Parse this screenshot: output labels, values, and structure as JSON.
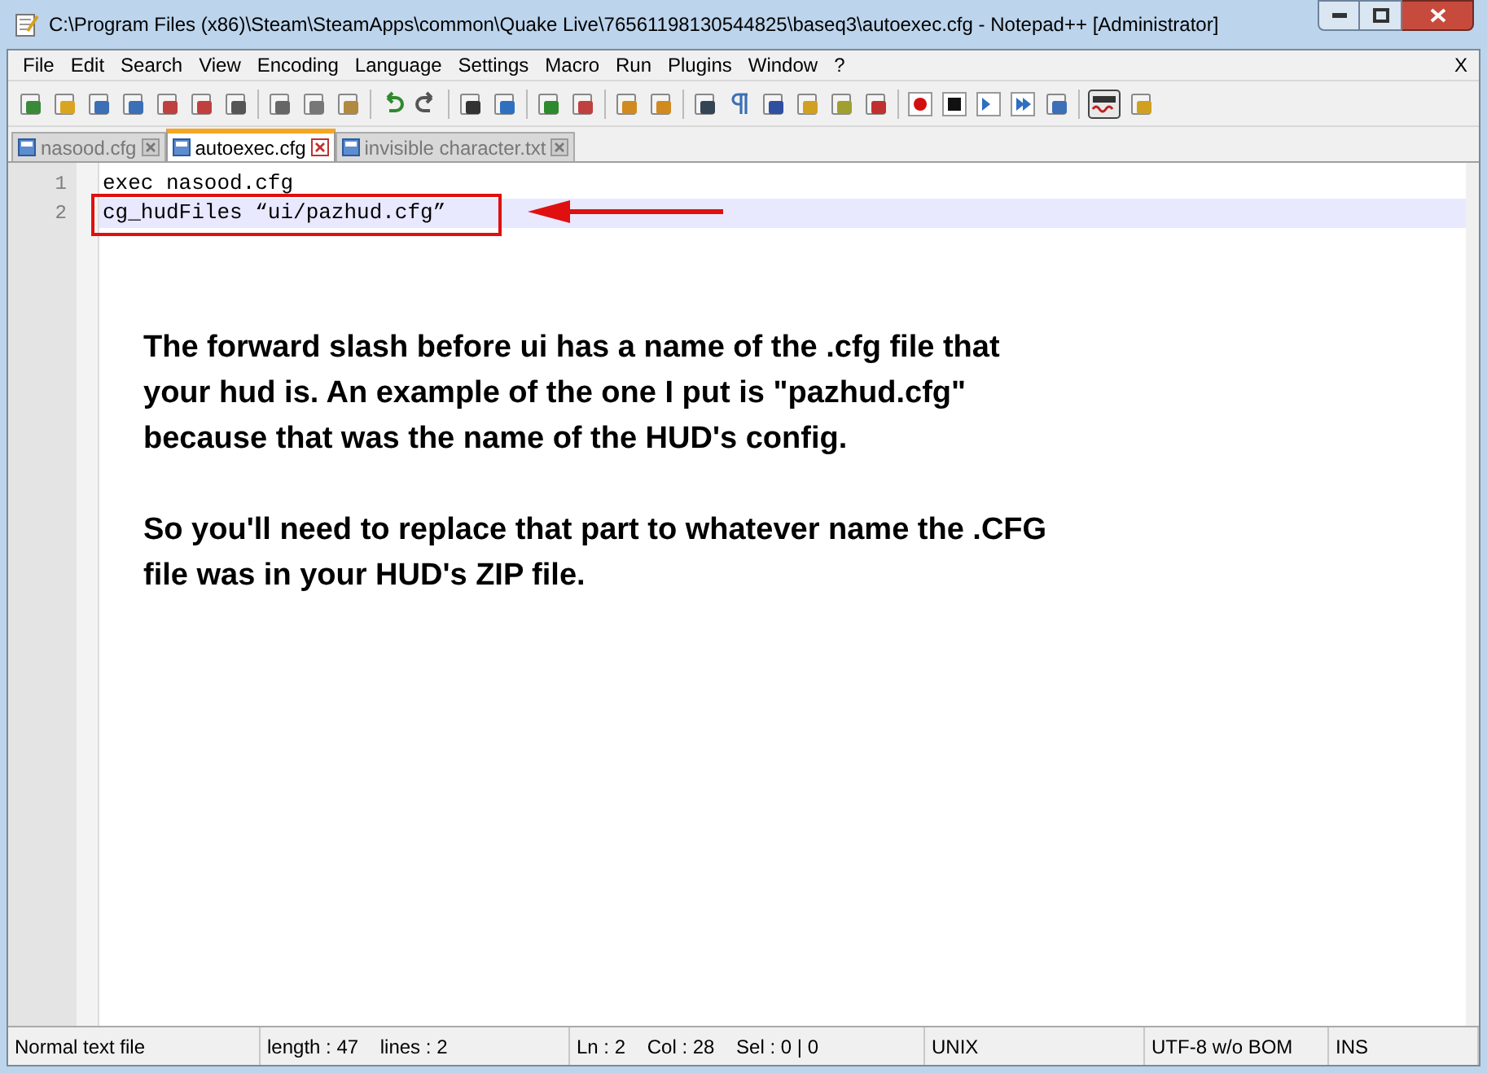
{
  "window": {
    "title": "C:\\Program Files (x86)\\Steam\\SteamApps\\common\\Quake Live\\76561198130544825\\baseq3\\autoexec.cfg - Notepad++ [Administrator]"
  },
  "menu": [
    {
      "label": "File"
    },
    {
      "label": "Edit"
    },
    {
      "label": "Search"
    },
    {
      "label": "View"
    },
    {
      "label": "Encoding"
    },
    {
      "label": "Language"
    },
    {
      "label": "Settings"
    },
    {
      "label": "Macro"
    },
    {
      "label": "Run"
    },
    {
      "label": "Plugins"
    },
    {
      "label": "Window"
    },
    {
      "label": "?"
    }
  ],
  "menu_close": "X",
  "tabs": [
    {
      "label": "nasood.cfg",
      "selected": false
    },
    {
      "label": "autoexec.cfg",
      "selected": true
    },
    {
      "label": "invisible character.txt",
      "selected": false
    }
  ],
  "editor": {
    "lines": [
      {
        "number": "1",
        "text": "exec nasood.cfg",
        "current": false
      },
      {
        "number": "2",
        "text": "cg_hudFiles “ui/pazhud.cfg”",
        "current": true
      }
    ]
  },
  "annotation": [
    "The forward slash before ui has a name of the .cfg file that your hud is. An example of the one I put is \"pazhud.cfg\" because that was the name of the HUD's config.",
    "So you'll need to replace that part to whatever name the .CFG file was in your HUD's ZIP file."
  ],
  "status_bar": [
    "Normal text file",
    "length : 47    lines : 2",
    "Ln : 2    Col : 28    Sel : 0 | 0",
    "UNIX",
    "UTF-8 w/o BOM",
    "INS"
  ]
}
